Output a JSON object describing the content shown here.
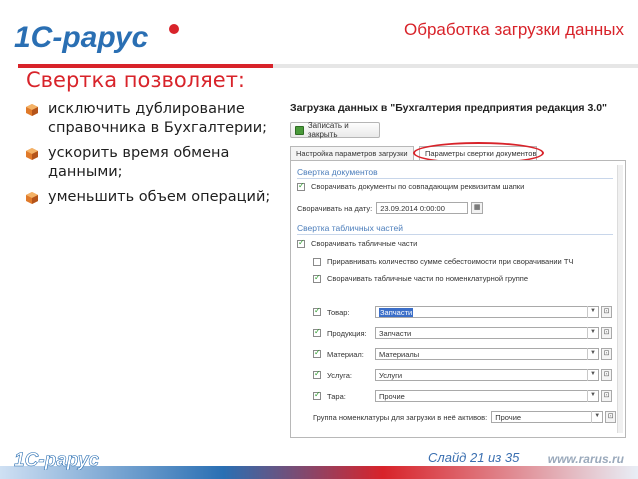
{
  "header": {
    "logo_text": "1С-рарус",
    "title": "Обработка загрузки данных"
  },
  "slide": {
    "heading": "Свертка позволяет:",
    "bullets": [
      {
        "text": "исключить дублирование справочника в Бухгалтерии;"
      },
      {
        "text": "ускорить время обмена данными;"
      },
      {
        "text": "уменьшить объем операций;"
      }
    ]
  },
  "window": {
    "title": "Загрузка данных в \"Бухгалтерия предприятия редакция 3.0\"",
    "toolbar": {
      "save_close_label": "Записать и закрыть"
    },
    "tabs": [
      {
        "label": "Настройка параметров загрузки",
        "active": false
      },
      {
        "label": "Параметры свертки документов",
        "active": true
      }
    ],
    "docs_section": {
      "title": "Свертка документов",
      "collapse_docs_label": "Сворачивать документы по совпадающим реквизитам шапки",
      "collapse_docs_checked": true,
      "date_label": "Сворачивать на дату:",
      "date_value": "23.09.2014  0:00:00"
    },
    "tables_section": {
      "title": "Свертка табличных частей",
      "collapse_tables_label": "Сворачивать табличные части",
      "collapse_tables_checked": true,
      "qty_label": "Приравнивать количество сумме себестоимости при сворачивании ТЧ",
      "qty_checked": false,
      "nomen_label": "Сворачивать табличные части по номенклатурной группе",
      "nomen_checked": true
    },
    "fields": [
      {
        "label": "Товар:",
        "value": "Запчасти",
        "checked": true,
        "selected": true
      },
      {
        "label": "Продукция:",
        "value": "Запчасти",
        "checked": true,
        "selected": false
      },
      {
        "label": "Материал:",
        "value": "Материалы",
        "checked": true,
        "selected": false
      },
      {
        "label": "Услуга:",
        "value": "Услуги",
        "checked": true,
        "selected": false
      },
      {
        "label": "Тара:",
        "value": "Прочие",
        "checked": true,
        "selected": false
      }
    ],
    "assets_group": {
      "label": "Группа номенклатуры для загрузки в неё активов:",
      "value": "Прочие"
    }
  },
  "footer": {
    "logo_text": "1С-рарус",
    "slide_number": "Слайд 21 из 35",
    "url": "www.rarus.ru"
  },
  "colors": {
    "brand_red": "#d8232a",
    "brand_blue": "#2a6fb3",
    "section_blue": "#4b7dbb"
  }
}
